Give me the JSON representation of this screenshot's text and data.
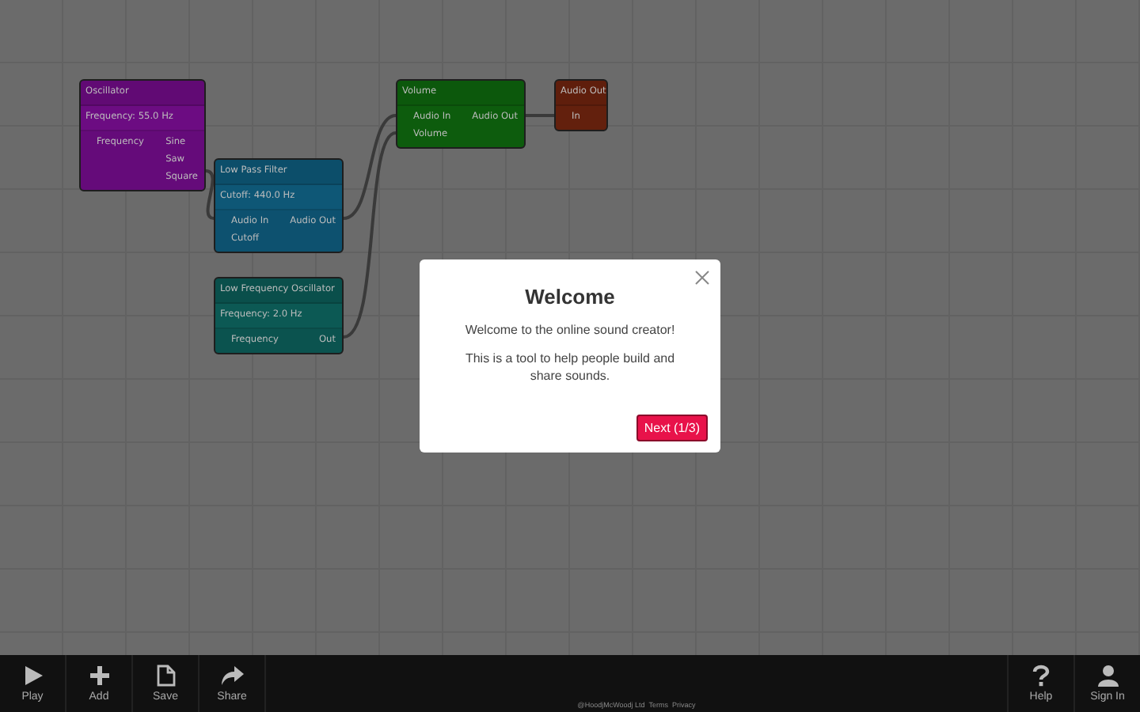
{
  "nodes": [
    {
      "title": "Oscillator",
      "color": "#6c0c82",
      "params": [
        "Frequency: 55.0 Hz"
      ],
      "inputs": [
        "Frequency"
      ],
      "outputs": [
        "Sine",
        "Saw",
        "Square"
      ]
    },
    {
      "title": "Low Pass Filter",
      "color": "#0e5776",
      "params": [
        "Cutoff: 440.0 Hz"
      ],
      "inputs": [
        "Audio In",
        "Cutoff"
      ],
      "outputs": [
        "Audio Out"
      ]
    },
    {
      "title": "Low Frequency Oscillator",
      "color": "#0c5954",
      "params": [
        "Frequency: 2.0 Hz"
      ],
      "inputs": [
        "Frequency"
      ],
      "outputs": [
        "Out"
      ]
    },
    {
      "title": "Volume",
      "color": "#0e620e",
      "inputs": [
        "Audio In",
        "Volume"
      ],
      "outputs": [
        "Audio Out"
      ]
    },
    {
      "title": "Audio Out",
      "color": "#6a220e",
      "inputs": [
        "In"
      ]
    }
  ],
  "dialog": {
    "title": "Welcome",
    "paragraphs": [
      "Welcome to the online sound creator!",
      "This is a tool to help people build and share sounds."
    ],
    "next_button": "Next (1/3)"
  },
  "toolbar": {
    "left": [
      {
        "kind": "play",
        "label": "Play"
      },
      {
        "kind": "add",
        "label": "Add"
      },
      {
        "kind": "save",
        "label": "Save"
      },
      {
        "kind": "share",
        "label": "Share"
      }
    ],
    "right": [
      {
        "kind": "help",
        "label": "Help"
      },
      {
        "kind": "user",
        "label": "Sign In"
      }
    ],
    "footer": "@HoodjMcWoodj Ltd  Terms  Privacy"
  }
}
